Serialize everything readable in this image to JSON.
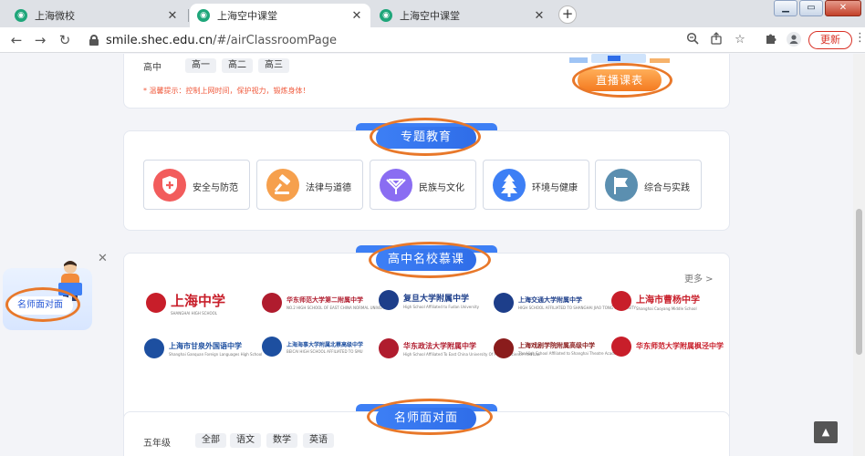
{
  "browser": {
    "tabs": [
      {
        "title": "上海微校",
        "close": "✕"
      },
      {
        "title": "上海空中课堂",
        "close": "✕"
      },
      {
        "title": "上海空中课堂",
        "close": "✕"
      }
    ],
    "new_tab": "+",
    "window_controls": {
      "minimize": "▁",
      "maximize": "▭",
      "close": "✕"
    },
    "url_host": "smile.shec.edu.cn",
    "url_path": "/#/airClassroomPage",
    "nav": {
      "back": "←",
      "forward": "→",
      "reload": "↻"
    },
    "update_label": "更新",
    "menu": "⋮"
  },
  "grade_card": {
    "level_label": "高中",
    "grades": [
      "高一",
      "高二",
      "高三"
    ],
    "tip": "* 温馨提示：控制上网时间，保护视力，锻炼身体！",
    "live_button": "直播课表"
  },
  "topics": {
    "title": "专题教育",
    "items": [
      {
        "label": "安全与防范",
        "icon": "shield-icon",
        "color": "#f25c5c"
      },
      {
        "label": "法律与道德",
        "icon": "gavel-icon",
        "color": "#f6a04d"
      },
      {
        "label": "民族与文化",
        "icon": "culture-icon",
        "color": "#8a6df2"
      },
      {
        "label": "环境与健康",
        "icon": "tree-icon",
        "color": "#3d7ff5"
      },
      {
        "label": "综合与实践",
        "icon": "flag-icon",
        "color": "#5b8fb0"
      }
    ]
  },
  "mooc": {
    "title": "高中名校慕课",
    "more": "更多 >",
    "schools": [
      {
        "name": "上海中学",
        "en": "SHANGHAI HIGH SCHOOL",
        "color": "#c81e2a"
      },
      {
        "name": "华东师范大学第二附属中学",
        "en": "NO.2 HIGH SCHOOL OF EAST CHINA NORMAL UNIVERSITY",
        "color": "#b01c2e"
      },
      {
        "name": "复旦大学附属中学",
        "en": "High School Affiliated to Fudan University",
        "color": "#1d3e8a"
      },
      {
        "name": "上海交通大学附属中学",
        "en": "HIGH SCHOOL AFFILIATED TO SHANGHAI JIAO TONG UNIVERSITY",
        "color": "#1d3e8a"
      },
      {
        "name": "上海市曹杨中学",
        "en": "Shanghai Caoyang Middle School",
        "color": "#c81e2a"
      },
      {
        "name": "上海市甘泉外国语中学",
        "en": "Shanghai Ganquan Foreign Languages High School",
        "color": "#1d4fa0"
      },
      {
        "name": "上海海事大学附属北蔡高级中学",
        "en": "BEICAI HIGH SCHOOL AFFILIATED TO SMU",
        "color": "#1d4fa0"
      },
      {
        "name": "华东政法大学附属中学",
        "en": "High School Affiliated To East China University Of Political Science And Law",
        "color": "#b01c2e"
      },
      {
        "name": "上海戏剧学院附属高级中学",
        "en": "The High School Affiliated to Shanghai Theatre Academy",
        "color": "#8a1c1c"
      },
      {
        "name": "华东师范大学附属枫泾中学",
        "en": "",
        "color": "#c81e2a"
      }
    ]
  },
  "teachers": {
    "title": "名师面对面",
    "grade_label": "五年级",
    "subjects": [
      "全部",
      "语文",
      "数学",
      "英语"
    ]
  },
  "floating": {
    "label": "名师面对面",
    "close": "✕"
  },
  "back_to_top": "▲"
}
